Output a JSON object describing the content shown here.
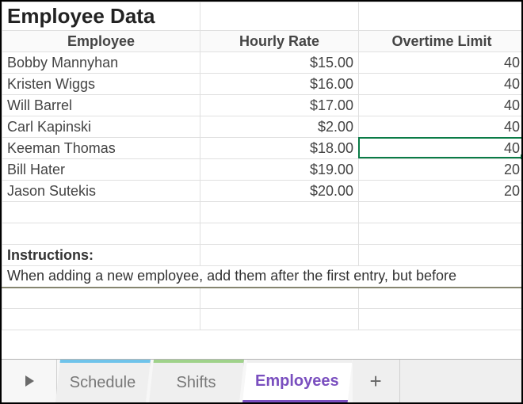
{
  "title": "Employee Data",
  "columns": {
    "employee": "Employee",
    "hourly_rate": "Hourly Rate",
    "overtime_limit": "Overtime Limit"
  },
  "rows": [
    {
      "employee": "Bobby Mannyhan",
      "hourly_rate": "$15.00",
      "overtime_limit": "40"
    },
    {
      "employee": "Kristen Wiggs",
      "hourly_rate": "$16.00",
      "overtime_limit": "40"
    },
    {
      "employee": "Will Barrel",
      "hourly_rate": "$17.00",
      "overtime_limit": "40"
    },
    {
      "employee": "Carl Kapinski",
      "hourly_rate": "$2.00",
      "overtime_limit": "40"
    },
    {
      "employee": "Keeman Thomas",
      "hourly_rate": "$18.00",
      "overtime_limit": "40"
    },
    {
      "employee": "Bill Hater",
      "hourly_rate": "$19.00",
      "overtime_limit": "20"
    },
    {
      "employee": "Jason Sutekis",
      "hourly_rate": "$20.00",
      "overtime_limit": "20"
    }
  ],
  "selected_cell": {
    "row_index": 4,
    "col": "c"
  },
  "instructions": {
    "label": "Instructions:",
    "text": "When adding a new employee, add them after the first entry, but before"
  },
  "tabs": {
    "schedule": "Schedule",
    "shifts": "Shifts",
    "employees": "Employees",
    "new": "+"
  }
}
